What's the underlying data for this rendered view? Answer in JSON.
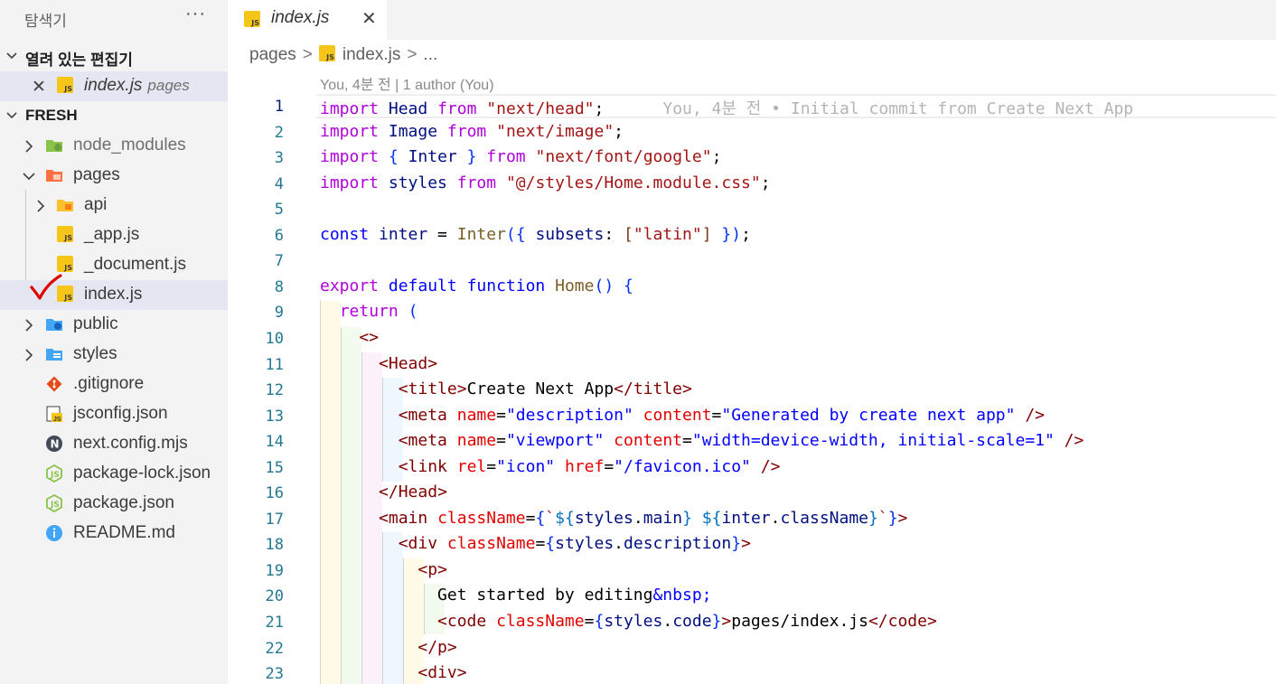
{
  "explorer": {
    "title": "탐색기",
    "more": "···",
    "open_editors": {
      "title": "열려 있는 편집기",
      "items": [
        {
          "name": "index.js",
          "description": "pages"
        }
      ]
    },
    "project": {
      "title": "FRESH",
      "tree": [
        {
          "name": "node_modules"
        },
        {
          "name": "pages"
        },
        {
          "name": "api"
        },
        {
          "name": "_app.js"
        },
        {
          "name": "_document.js"
        },
        {
          "name": "index.js"
        },
        {
          "name": "public"
        },
        {
          "name": "styles"
        },
        {
          "name": ".gitignore"
        },
        {
          "name": "jsconfig.json"
        },
        {
          "name": "next.config.mjs"
        },
        {
          "name": "package-lock.json"
        },
        {
          "name": "package.json"
        },
        {
          "name": "README.md"
        }
      ]
    }
  },
  "editor": {
    "tab": {
      "label": "index.js",
      "close": "✕"
    },
    "breadcrumb": {
      "folder": "pages",
      "sep": ">",
      "file": "index.js",
      "more": "..."
    },
    "blame_header": "You, 4분 전 | 1 author (You)",
    "inline_blame": "You, 4분 전 • Initial commit from Create Next App",
    "line_numbers": [
      "1",
      "2",
      "3",
      "4",
      "5",
      "6",
      "7",
      "8",
      "9",
      "10",
      "11",
      "12",
      "13",
      "14",
      "15",
      "16",
      "17",
      "18",
      "19",
      "20",
      "21",
      "22",
      "23"
    ],
    "code_lines": [
      "import Head from \"next/head\";",
      "import Image from \"next/image\";",
      "import { Inter } from \"next/font/google\";",
      "import styles from \"@/styles/Home.module.css\";",
      "",
      "const inter = Inter({ subsets: [\"latin\"] });",
      "",
      "export default function Home() {",
      "  return (",
      "    <>",
      "      <Head>",
      "        <title>Create Next App</title>",
      "        <meta name=\"description\" content=\"Generated by create next app\" />",
      "        <meta name=\"viewport\" content=\"width=device-width, initial-scale=1\" />",
      "        <link rel=\"icon\" href=\"/favicon.ico\" />",
      "      </Head>",
      "      <main className={`${styles.main} ${inter.className}`}>",
      "        <div className={styles.description}>",
      "          <p>",
      "            Get started by editing&nbsp;",
      "            <code className={styles.code}>pages/index.js</code>",
      "          </p>",
      "          <div>"
    ]
  },
  "icons": {
    "annotation": "red-checkmark-icon",
    "js_badge_text": "JS"
  },
  "colors": {
    "keyword": "#0000ff",
    "control": "#af00db",
    "string": "#a31515",
    "variable": "#001080",
    "function": "#795e26",
    "tag": "#800000",
    "attribute": "#e50000",
    "line_number": "#237893",
    "checkmark": "#e00000"
  }
}
